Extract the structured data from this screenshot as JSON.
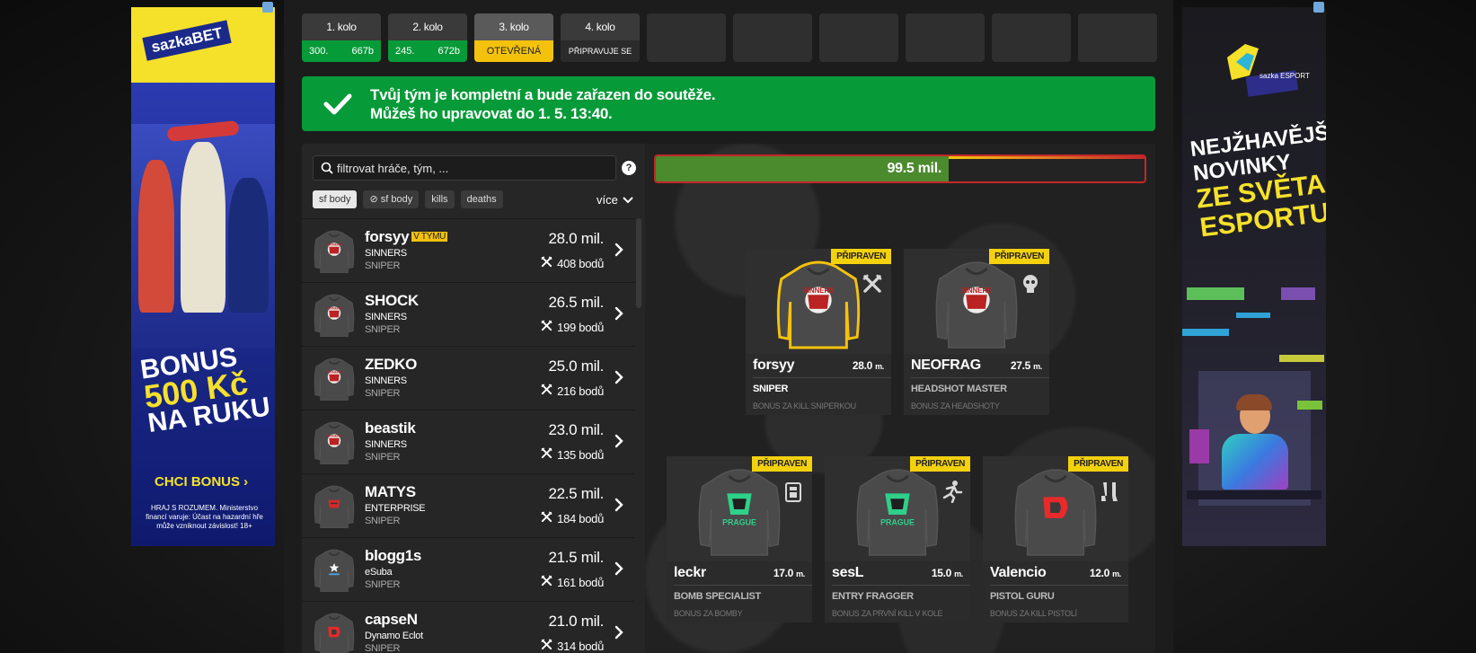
{
  "ads": {
    "left": {
      "logo": "sazkaBET",
      "bonus_line1": "BONUS",
      "bonus_line2": "500 Kč",
      "bonus_line3": "NA RUKU",
      "cta": "CHCI BONUS",
      "legal": "HRAJ S ROZUMEM. Ministerstvo financí varuje: Účast na hazardní hře může vzniknout závislost! 18+"
    },
    "right": {
      "logo": "sazka ESPORT",
      "line1": "NEJŽHAVĚJŠÍ",
      "line2": "NOVINKY",
      "line3": "ZE SVĚTA",
      "line4": "ESPORTU"
    }
  },
  "rounds": [
    {
      "name": "1. kolo",
      "left": "300.",
      "right": "667b",
      "status": "green"
    },
    {
      "name": "2. kolo",
      "left": "245.",
      "right": "672b",
      "status": "green"
    },
    {
      "name": "3. kolo",
      "label": "OTEVŘENÁ",
      "status": "yellow"
    },
    {
      "name": "4. kolo",
      "label": "PŘIPRAVUJE SE",
      "status": "gray"
    }
  ],
  "banner": {
    "line1": "Tvůj tým je kompletní a bude zařazen do soutěže.",
    "line2": "Můžeš ho upravovat do 1. 5. 13:40."
  },
  "filter": {
    "placeholder": "filtrovat hráče, tým, ...",
    "help": "?",
    "chips": [
      "sf body",
      "sf body",
      "kills",
      "deaths"
    ],
    "more": "více"
  },
  "players": [
    {
      "name": "forsyy",
      "tag": "V TÝMU",
      "team": "SINNERS",
      "role": "SNIPER",
      "price": "28.0 mil.",
      "points": "408 bodů",
      "logo": "sinners"
    },
    {
      "name": "SHOCK",
      "team": "SINNERS",
      "role": "SNIPER",
      "price": "26.5 mil.",
      "points": "199 bodů",
      "logo": "sinners"
    },
    {
      "name": "ZEDKO",
      "team": "SINNERS",
      "role": "SNIPER",
      "price": "25.0 mil.",
      "points": "216 bodů",
      "logo": "sinners"
    },
    {
      "name": "beastik",
      "team": "SINNERS",
      "role": "SNIPER",
      "price": "23.0 mil.",
      "points": "135 bodů",
      "logo": "sinners"
    },
    {
      "name": "MATYS",
      "team": "ENTERPRISE",
      "role": "SNIPER",
      "price": "22.5 mil.",
      "points": "184 bodů",
      "logo": "enterprise"
    },
    {
      "name": "blogg1s",
      "team": "eSuba",
      "role": "SNIPER",
      "price": "21.5 mil.",
      "points": "161 bodů",
      "logo": "esuba"
    },
    {
      "name": "capseN",
      "team": "Dynamo Eclot",
      "role": "SNIPER",
      "price": "21.0 mil.",
      "points": "314 bodů",
      "logo": "dynamo"
    }
  ],
  "budget": {
    "value": "99.5 mil.",
    "fill_percent": 40
  },
  "lineup": [
    {
      "name": "forsyy",
      "price": "28.0",
      "unit": "m.",
      "role": "SNIPER",
      "bonus": "BONUS ZA KILL SNIPERKOU",
      "status": "PŘIPRAVEN",
      "logo": "sinners",
      "badge": "cross-swords-icon",
      "selected": true
    },
    {
      "name": "NEOFRAG",
      "price": "27.5",
      "unit": "m.",
      "role": "HEADSHOT MASTER",
      "bonus": "BONUS ZA HEADSHOTY",
      "status": "PŘIPRAVEN",
      "logo": "sinners",
      "badge": "skull-icon",
      "selected": false
    },
    {
      "name": "leckr",
      "price": "17.0",
      "unit": "m.",
      "role": "BOMB SPECIALIST",
      "bonus": "BONUS ZA BOMBY",
      "status": "PŘIPRAVEN",
      "logo": "enterprise-prague",
      "badge": "bomb-icon",
      "selected": false
    },
    {
      "name": "sesL",
      "price": "15.0",
      "unit": "m.",
      "role": "ENTRY FRAGGER",
      "bonus": "BONUS ZA PRVNÍ KILL V KOLE",
      "status": "PŘIPRAVEN",
      "logo": "enterprise-prague",
      "badge": "runner-icon",
      "selected": false
    },
    {
      "name": "Valencio",
      "price": "12.0",
      "unit": "m.",
      "role": "PISTOL GURU",
      "bonus": "BONUS ZA KILL PISTOLÍ",
      "status": "PŘIPRAVEN",
      "logo": "dynamo",
      "badge": "pistols-icon",
      "selected": false
    }
  ],
  "colors": {
    "green": "#079a39",
    "yellow": "#f4c20d",
    "red": "#c42828",
    "panel": "#262626"
  }
}
